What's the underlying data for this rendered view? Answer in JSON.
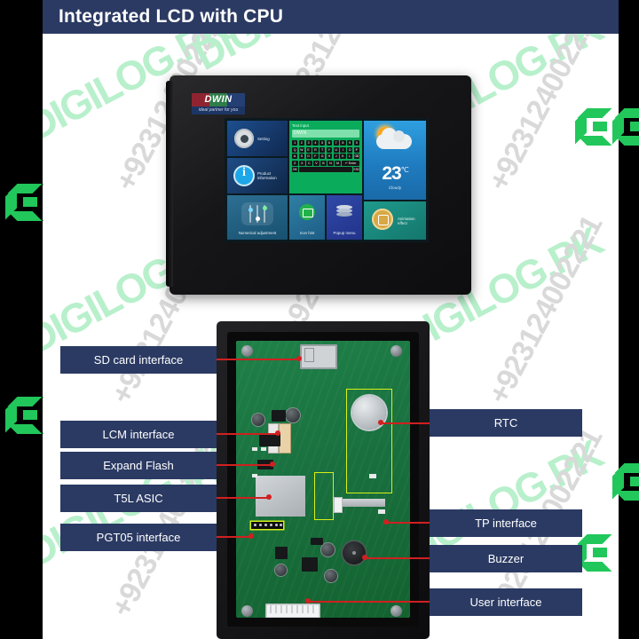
{
  "header": {
    "title": "Integrated LCD with CPU",
    "bg": "#2b3a63"
  },
  "watermark": {
    "word": "DIGILOG.PK",
    "phone": "+923124002221",
    "word_color": "#b8f0cc",
    "phone_color": "#d9d9d9",
    "mark": "digilog-logo-mark"
  },
  "device": {
    "brand": "DWIN",
    "brand_tagline": "ideal partner for you",
    "screen": {
      "tiles": [
        {
          "id": "setting",
          "label": "Setting",
          "icon": "gear-icon"
        },
        {
          "id": "product",
          "label": "Product information",
          "icon": "info-icon"
        },
        {
          "id": "numeric",
          "label": "Numerical adjustment",
          "icon": "sliders-icon"
        },
        {
          "id": "icon-hint",
          "label": "Icon hint",
          "icon": "window-icon"
        },
        {
          "id": "popup",
          "label": "Popup menu",
          "icon": "layers-icon"
        },
        {
          "id": "animation",
          "label": "Animation effect",
          "icon": "animation-icon"
        }
      ],
      "keyboard": {
        "title": "Text input",
        "value": "DWIN",
        "rows": [
          [
            "1",
            "2",
            "3",
            "4",
            "5",
            "6",
            "7",
            "8",
            "9",
            "0"
          ],
          [
            "Q",
            "W",
            "E",
            "R",
            "T",
            "Y",
            "U",
            "I",
            "O",
            "P"
          ],
          [
            "A",
            "S",
            "D",
            "F",
            "G",
            "H",
            "J",
            "K",
            "L",
            "⌫"
          ],
          [
            "Z",
            "X",
            "C",
            "V",
            "B",
            "N",
            "M",
            "↵ Enter"
          ]
        ],
        "ok_label": "OK",
        "esc_label": "ESC"
      },
      "weather": {
        "temperature": "23",
        "unit": "℃",
        "condition": "Cloudy",
        "icon": "sun-behind-cloud-icon"
      }
    }
  },
  "callouts": {
    "left": [
      {
        "id": "sd-card-interface",
        "label": "SD card interface"
      },
      {
        "id": "lcm-interface",
        "label": "LCM interface"
      },
      {
        "id": "expand-flash",
        "label": "Expand Flash"
      },
      {
        "id": "t5l-asic",
        "label": "T5L ASIC"
      },
      {
        "id": "pgt05-interface",
        "label": "PGT05 interface"
      }
    ],
    "right": [
      {
        "id": "rtc",
        "label": "RTC"
      },
      {
        "id": "tp-interface",
        "label": "TP interface"
      },
      {
        "id": "buzzer",
        "label": "Buzzer"
      },
      {
        "id": "user-interface",
        "label": "User interface"
      }
    ],
    "line_color": "#d02020",
    "box_color": "#2b3a63"
  }
}
